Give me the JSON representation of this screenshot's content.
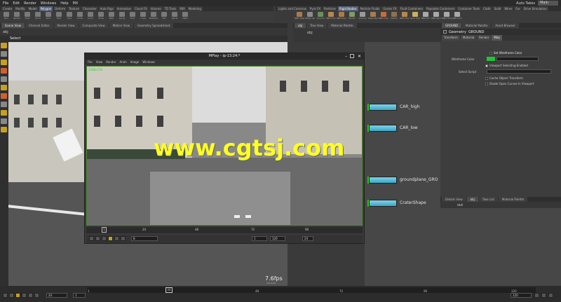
{
  "menubar": {
    "items": [
      "File",
      "Edit",
      "Render",
      "Windows",
      "Help",
      "MX"
    ],
    "auto_takes": "Auto Takes",
    "desktop": "Main"
  },
  "shelf_tabs_left": [
    "Create",
    "Modify",
    "Model",
    "Polygon",
    "Deform",
    "Texture",
    "Character",
    "Auto Rigs",
    "Animation",
    "Cloud FX",
    "Volume",
    "TD Tools",
    "MIX",
    "Modeling"
  ],
  "shelf_tabs_right": [
    "Lights and Cameras",
    "Pyro FX",
    "Particles",
    "Rigid Bodies",
    "Particle Fluids",
    "Grains FX",
    "Fluid Containers",
    "Populate Containers",
    "Container Tools",
    "Cloth",
    "Solid",
    "Wires",
    "Fur",
    "Drive Simulation"
  ],
  "tools_left": [
    "Box",
    "Sphere",
    "Tube",
    "Torus",
    "Grid",
    "Null",
    "Line",
    "Circle",
    "Curve",
    "Draw",
    "Path",
    "Spray",
    "Font",
    "L-Sys",
    "Metaball",
    "File",
    "Spiral",
    "Helix"
  ],
  "tools_right": [
    "RBD Object",
    "Static Obj",
    "Ground",
    "RBD Fract",
    "RBD Pieces",
    "Terrain",
    "Voronoi",
    "Make Bre",
    "RBD Impac",
    "Debris",
    "RBD Frac",
    "Glue Adju",
    "RBD Pin",
    "RBD Spring",
    "RBD Hinge",
    "RBD Cons"
  ],
  "pane_tabs_left": [
    "Scene View",
    "Channel Editor",
    "Render View",
    "Composite View",
    "Motion View",
    "Geometry Spreadsheet"
  ],
  "pane_tabs_mid": [
    "obj",
    "Tree View",
    "Material Palette"
  ],
  "pane_tabs_right": [
    "GROUND",
    "Material Palette",
    "Asset Browser"
  ],
  "viewport": {
    "select_label": "Select",
    "path": "obj",
    "fps": "7.6fps",
    "fps_sub": "131.2ms"
  },
  "mplay": {
    "title": "MPlay - ip-13:24:*",
    "menu": [
      "File",
      "View",
      "Render",
      "Anim",
      "Image",
      "Windows"
    ],
    "res_label": "1280x720",
    "frame_start": "1",
    "frame_end": "120",
    "current_frame": "8",
    "fps_field": "24",
    "ruler_ticks": [
      "24",
      "48",
      "72",
      "96"
    ],
    "start_marker": "1"
  },
  "network_nodes": [
    {
      "name": "CAR_high"
    },
    {
      "name": "CAR_low"
    },
    {
      "name": "groundplane_GRO"
    },
    {
      "name": "CraterShape"
    }
  ],
  "parameter_pane": {
    "node_type": "Geometry",
    "node_name": "GROUND",
    "tabs": [
      "Transform",
      "Material",
      "Render",
      "Misc"
    ],
    "set_wireframe_color": "Set Wireframe Color",
    "wireframe_color_label": "Wireframe Color",
    "viewport_selecting": "Viewport Selecting Enabled",
    "select_script_label": "Select Script",
    "cache_object_transform": "Cache Object Transform",
    "shade_open_curves": "Shade Open Curves In Viewport"
  },
  "lower_net": {
    "tabs": [
      "Details View",
      "obj",
      "Take List",
      "Material Palette"
    ],
    "path": "out"
  },
  "timeline": {
    "current_frame": "24",
    "start": "1",
    "end": "120",
    "range_start": "1",
    "range_end": "120",
    "ticks": [
      "24",
      "48",
      "72",
      "96",
      "120"
    ]
  },
  "watermark": "www.cgtsj.com",
  "colors": {
    "accent": "#57627a",
    "node_flag": "#38c020",
    "watermark": "#ffff22",
    "wire_color": "#23c23a"
  }
}
